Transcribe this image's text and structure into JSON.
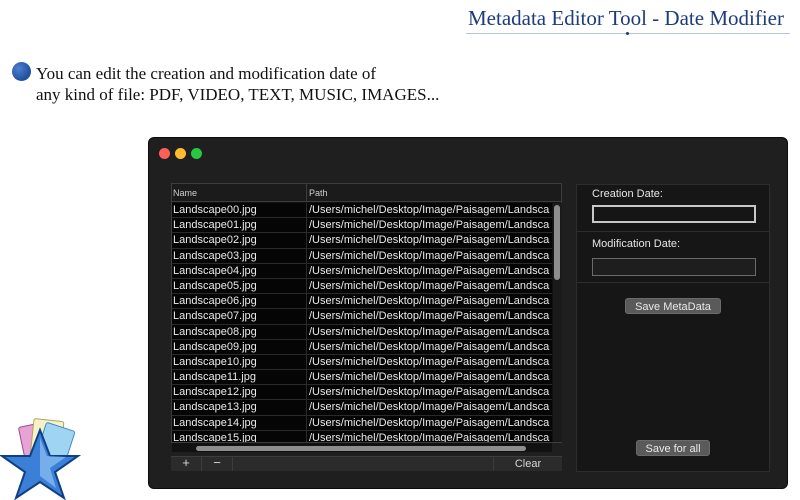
{
  "promo": {
    "title": "Metadata Editor Tool - Date Modifier",
    "line1": "You can edit the creation and modification date of",
    "line2": "any kind of file: PDF, VIDEO, TEXT, MUSIC, IMAGES..."
  },
  "table": {
    "headers": {
      "name": "Name",
      "path": "Path"
    },
    "rows": [
      {
        "name": "Landscape00.jpg",
        "path": "/Users/michel/Desktop/Image/Paisagem/Landscap"
      },
      {
        "name": "Landscape01.jpg",
        "path": "/Users/michel/Desktop/Image/Paisagem/Landscap"
      },
      {
        "name": "Landscape02.jpg",
        "path": "/Users/michel/Desktop/Image/Paisagem/Landscap"
      },
      {
        "name": "Landscape03.jpg",
        "path": "/Users/michel/Desktop/Image/Paisagem/Landscap"
      },
      {
        "name": "Landscape04.jpg",
        "path": "/Users/michel/Desktop/Image/Paisagem/Landscap"
      },
      {
        "name": "Landscape05.jpg",
        "path": "/Users/michel/Desktop/Image/Paisagem/Landscap"
      },
      {
        "name": "Landscape06.jpg",
        "path": "/Users/michel/Desktop/Image/Paisagem/Landscap"
      },
      {
        "name": "Landscape07.jpg",
        "path": "/Users/michel/Desktop/Image/Paisagem/Landscap"
      },
      {
        "name": "Landscape08.jpg",
        "path": "/Users/michel/Desktop/Image/Paisagem/Landscap"
      },
      {
        "name": "Landscape09.jpg",
        "path": "/Users/michel/Desktop/Image/Paisagem/Landscap"
      },
      {
        "name": "Landscape10.jpg",
        "path": "/Users/michel/Desktop/Image/Paisagem/Landscap"
      },
      {
        "name": "Landscape11.jpg",
        "path": "/Users/michel/Desktop/Image/Paisagem/Landscap"
      },
      {
        "name": "Landscape12.jpg",
        "path": "/Users/michel/Desktop/Image/Paisagem/Landscap"
      },
      {
        "name": "Landscape13.jpg",
        "path": "/Users/michel/Desktop/Image/Paisagem/Landscap"
      },
      {
        "name": "Landscape14.jpg",
        "path": "/Users/michel/Desktop/Image/Paisagem/Landscap"
      },
      {
        "name": "Landscape15.jpg",
        "path": "/Users/michel/Desktop/Image/Paisagem/Landscap"
      }
    ]
  },
  "toolbar": {
    "add_label": "+",
    "remove_label": "−",
    "clear_label": "Clear"
  },
  "side": {
    "creation_label": "Creation Date:",
    "creation_value": "",
    "modification_label": "Modification Date:",
    "modification_value": "",
    "save_metadata_label": "Save MetaData",
    "save_all_label": "Save for all"
  },
  "colors": {
    "window_bg": "#1f1f1f",
    "accent_title": "#1d3c7a",
    "bullet": "#1f4f9e",
    "traffic_close": "#fe5f57",
    "traffic_min": "#febc2e",
    "traffic_max": "#28c840"
  },
  "icons": {
    "app_logo": "star-logo-icon",
    "bullet": "bullet-dot-icon"
  }
}
